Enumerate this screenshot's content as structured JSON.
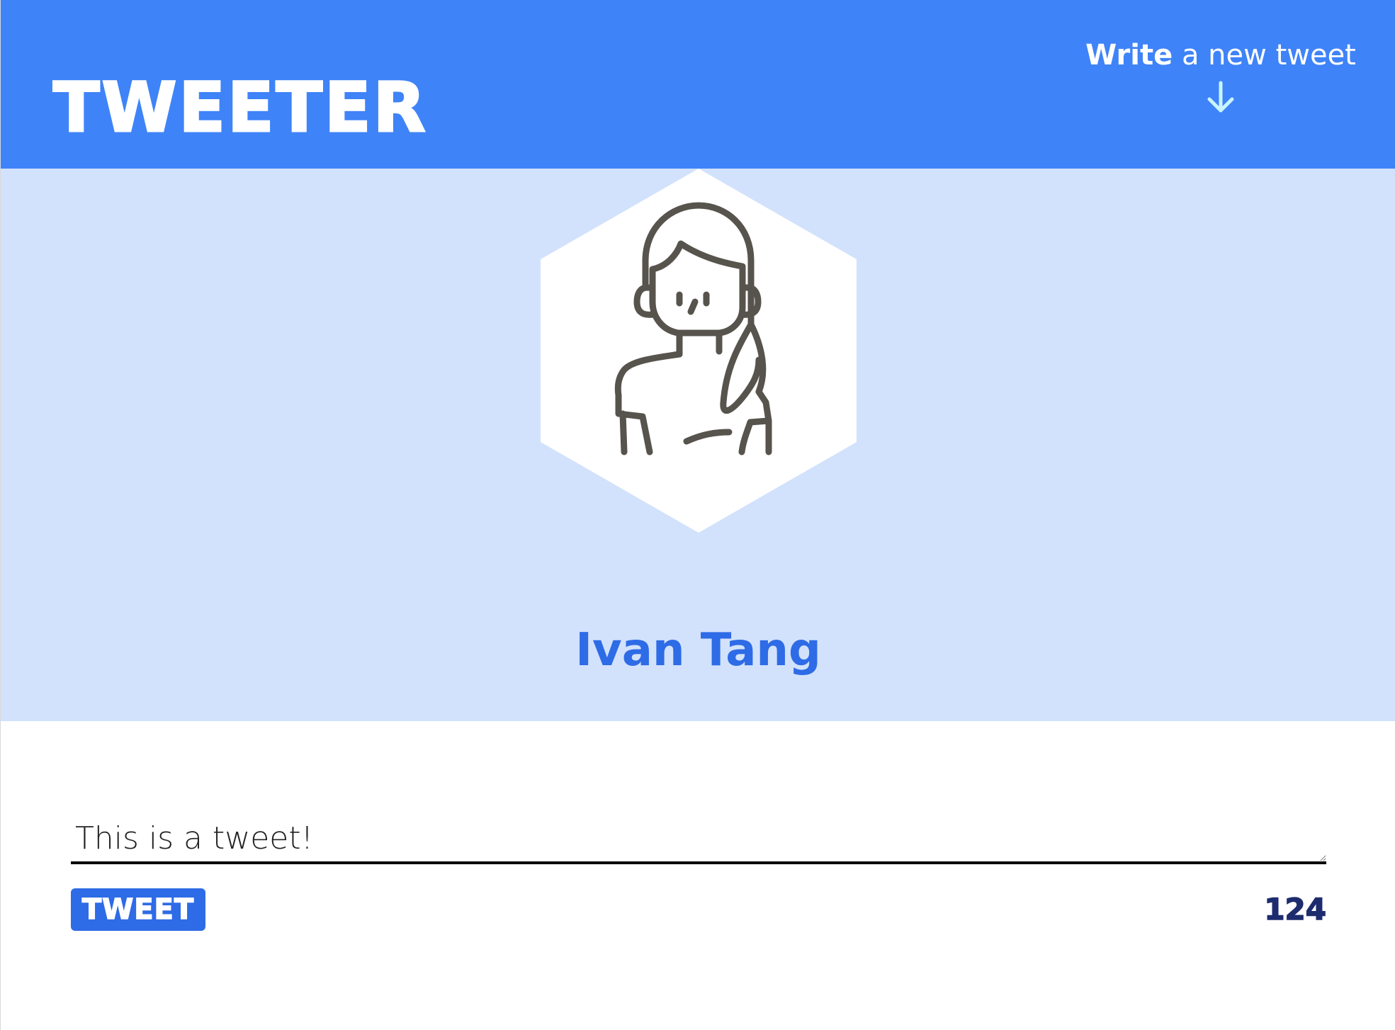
{
  "nav": {
    "logo": "TWEETER",
    "compose_bold": "Write",
    "compose_rest": " a new tweet",
    "arrow_icon": "arrow-down-icon"
  },
  "profile": {
    "avatar_icon": "user-avatar-icon",
    "name": "Ivan Tang"
  },
  "composer": {
    "text_value": "This is a tweet!",
    "button_label": "TWEET",
    "char_counter": "124"
  },
  "colors": {
    "header_bg": "#3f83f8",
    "profile_bg": "#d2e2fc",
    "accent": "#2e6be6",
    "counter": "#1c2c6e",
    "arrow": "#c8f5ff"
  }
}
